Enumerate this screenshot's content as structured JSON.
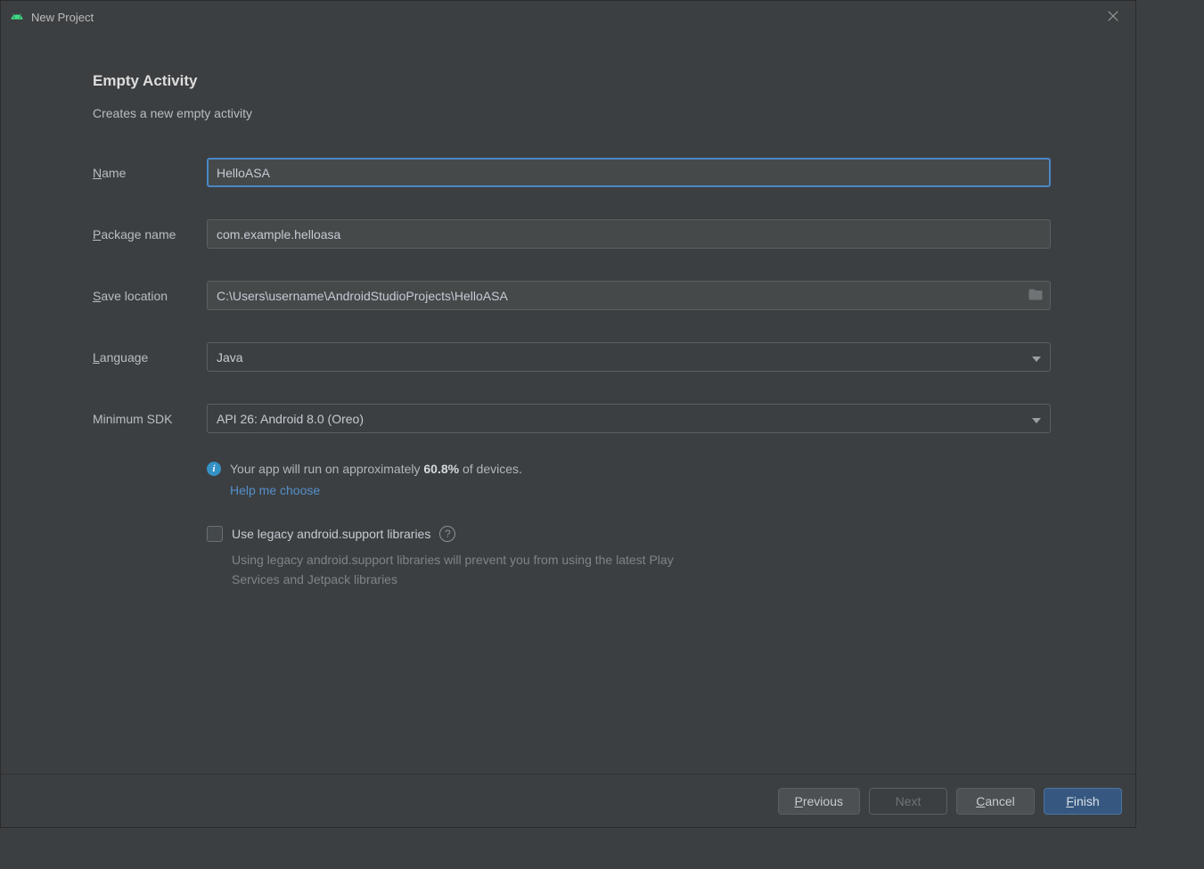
{
  "window": {
    "title": "New Project"
  },
  "heading": "Empty Activity",
  "subheading": "Creates a new empty activity",
  "fields": {
    "name": {
      "label_pre": "N",
      "label_post": "ame",
      "value": "HelloASA"
    },
    "package": {
      "label_pre": "P",
      "label_post": "ackage name",
      "value": "com.example.helloasa"
    },
    "save": {
      "label_pre": "S",
      "label_post": "ave location",
      "value": "C:\\Users\\username\\AndroidStudioProjects\\HelloASA"
    },
    "language": {
      "label_pre": "L",
      "label_post": "anguage",
      "value": "Java"
    },
    "minsdk": {
      "label": "Minimum SDK",
      "value": "API 26: Android 8.0 (Oreo)"
    }
  },
  "info": {
    "prefix": "Your app will run on approximately ",
    "percent": "60.8%",
    "suffix": " of devices.",
    "help_link": "Help me choose"
  },
  "legacy": {
    "label": "Use legacy android.support libraries",
    "desc": "Using legacy android.support libraries will prevent you from using the latest Play Services and Jetpack libraries"
  },
  "buttons": {
    "previous": {
      "pre": "P",
      "post": "revious"
    },
    "next": "Next",
    "cancel": {
      "pre": "C",
      "post": "ancel"
    },
    "finish": {
      "pre": "F",
      "post": "inish"
    }
  }
}
